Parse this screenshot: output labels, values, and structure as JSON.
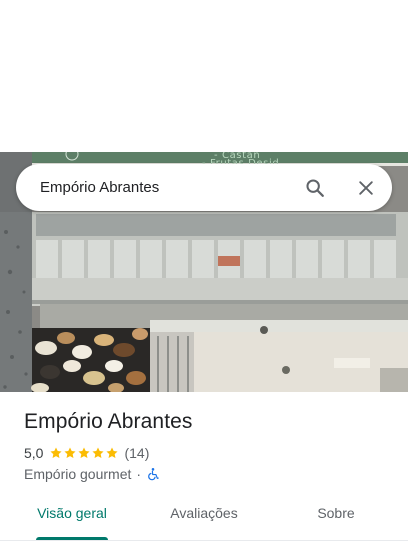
{
  "search": {
    "query": "Empório Abrantes",
    "search_icon": "search-icon",
    "close_icon": "close-icon"
  },
  "photo": {
    "sign_line_1": "- Castan",
    "sign_line_2": "- Frutas Desid"
  },
  "place": {
    "name": "Empório Abrantes",
    "rating": "5,0",
    "stars": 5,
    "star_color": "#fbbc04",
    "review_count": "(14)",
    "category": "Empório gourmet",
    "separator": "·",
    "accessibility_icon": "wheelchair-icon",
    "accessibility_color": "#1a73e8"
  },
  "tabs": [
    {
      "label": "Visão geral",
      "selected": true
    },
    {
      "label": "Avaliações",
      "selected": false
    },
    {
      "label": "Sobre",
      "selected": false
    }
  ],
  "colors": {
    "accent": "#00796b",
    "text_primary": "#202124",
    "text_secondary": "#5f6368"
  }
}
